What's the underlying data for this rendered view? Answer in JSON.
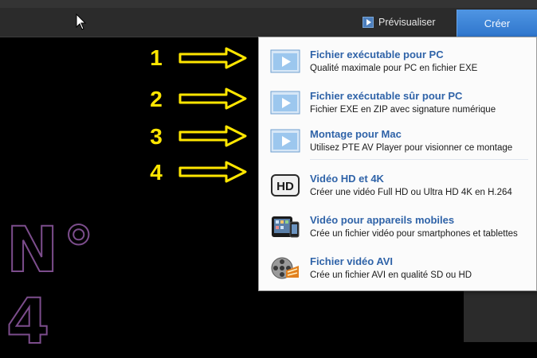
{
  "toolbar": {
    "preview_label": "Prévisualiser",
    "create_label": "Créer"
  },
  "annotations": {
    "numbers": [
      "1",
      "2",
      "3",
      "4"
    ],
    "color": "#ffe600",
    "background_text": "N° 4",
    "background_text_color": "#7c4d8c"
  },
  "menu": {
    "items": [
      {
        "title": "Fichier exécutable pour PC",
        "desc": "Qualité maximale pour PC en fichier EXE",
        "icon": "play-window-icon"
      },
      {
        "title": "Fichier exécutable sûr pour PC",
        "desc": "Fichier EXE en ZIP avec signature numérique",
        "icon": "play-window-icon"
      },
      {
        "title": "Montage pour Mac",
        "desc": "Utilisez PTE AV Player pour visionner ce montage",
        "icon": "play-window-icon"
      },
      {
        "title": "Vidéo HD et 4K",
        "desc": "Créer une vidéo Full HD ou Ultra HD 4K en H.264",
        "icon": "hd-icon"
      },
      {
        "title": "Vidéo pour appareils mobiles",
        "desc": "Crée un fichier vidéo pour smartphones et tablettes",
        "icon": "mobile-devices-icon"
      },
      {
        "title": "Fichier vidéo AVI",
        "desc": "Crée un fichier AVI en qualité SD ou HD",
        "icon": "film-reel-icon"
      }
    ],
    "hd_badge": "HD",
    "accent": "#2f63a8"
  }
}
